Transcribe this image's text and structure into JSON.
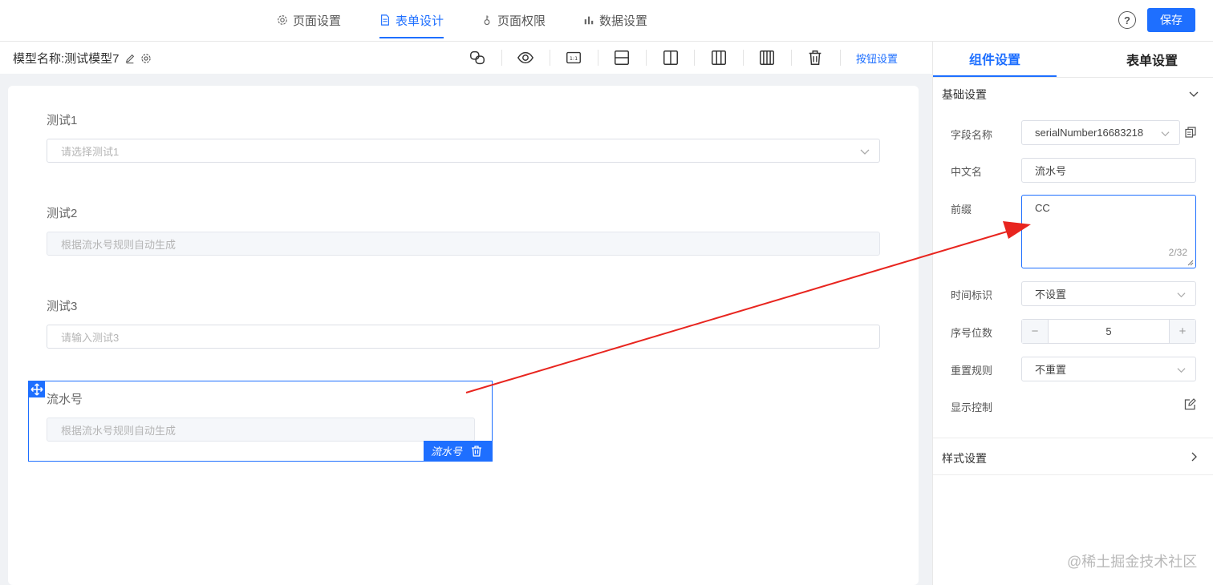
{
  "nav": {
    "tabs": [
      {
        "label": "页面设置",
        "icon": "gear-icon",
        "active": false
      },
      {
        "label": "表单设计",
        "icon": "document-icon",
        "active": true
      },
      {
        "label": "页面权限",
        "icon": "key-icon",
        "active": false
      },
      {
        "label": "数据设置",
        "icon": "bar-chart-icon",
        "active": false
      }
    ],
    "help": "?",
    "save_label": "保存",
    "accent": "#1e6fff"
  },
  "toolbar": {
    "model_label": "模型名称:",
    "model_name": "测试模型7",
    "button_settings": "按钮设置"
  },
  "form": {
    "fields": [
      {
        "label": "测试1",
        "placeholder": "请选择测试1",
        "type": "select"
      },
      {
        "label": "测试2",
        "placeholder": "根据流水号规则自动生成",
        "type": "disabled"
      },
      {
        "label": "测试3",
        "placeholder": "请输入测试3",
        "type": "input"
      },
      {
        "label": "流水号",
        "placeholder": "根据流水号规则自动生成",
        "type": "disabled"
      }
    ],
    "selected_tag": "流水号"
  },
  "panel": {
    "tabs": [
      "组件设置",
      "表单设置"
    ],
    "basic_title": "基础设置",
    "style_title": "样式设置",
    "field_name": {
      "label": "字段名称",
      "value": "serialNumber16683218"
    },
    "cn_name": {
      "label": "中文名",
      "value": "流水号"
    },
    "prefix": {
      "label": "前缀",
      "value": "CC",
      "counter": "2/32"
    },
    "time_mark": {
      "label": "时间标识",
      "value": "不设置"
    },
    "seq_digits": {
      "label": "序号位数",
      "value": "5",
      "minus": "−",
      "plus": "+"
    },
    "reset_rule": {
      "label": "重置规则",
      "value": "不重置"
    },
    "display_ctrl": {
      "label": "显示控制"
    }
  },
  "watermark": "@稀土掘金技术社区"
}
